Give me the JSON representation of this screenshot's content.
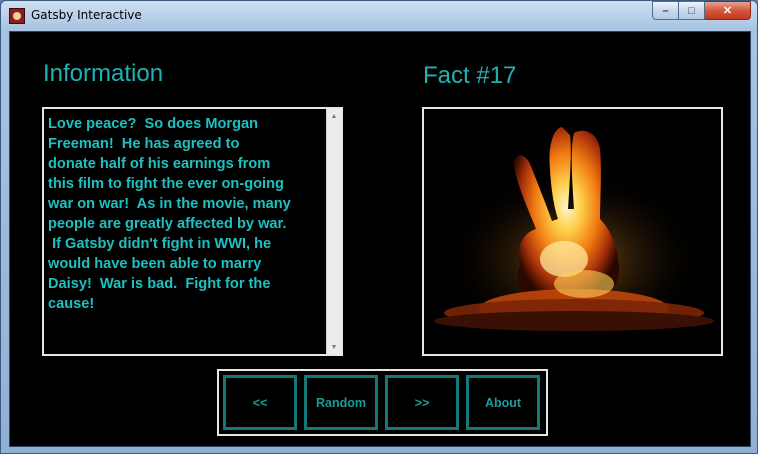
{
  "window": {
    "title": "Gatsby Interactive",
    "icon": "gatsby-app-icon",
    "controls": {
      "minimize": "–",
      "maximize": "□",
      "close": "✕"
    }
  },
  "info": {
    "heading": "Information",
    "text": "Love peace?  So does Morgan\nFreeman!  He has agreed to\ndonate half of his earnings from\nthis film to fight the ever on-going\nwar on war!  As in the movie, many\npeople are greatly affected by war.\n If Gatsby didn't fight in WWI, he\nwould have been able to marry\nDaisy!  War is bad.  Fight for the\ncause!"
  },
  "fact": {
    "heading": "Fact #17",
    "image": "peace-sign-fireball-explosion"
  },
  "nav": {
    "prev_label": "<<",
    "random_label": "Random",
    "next_label": ">>",
    "about_label": "About"
  },
  "colors": {
    "accent": "#1fb3b3",
    "background": "#000000",
    "button_border": "#157878"
  }
}
